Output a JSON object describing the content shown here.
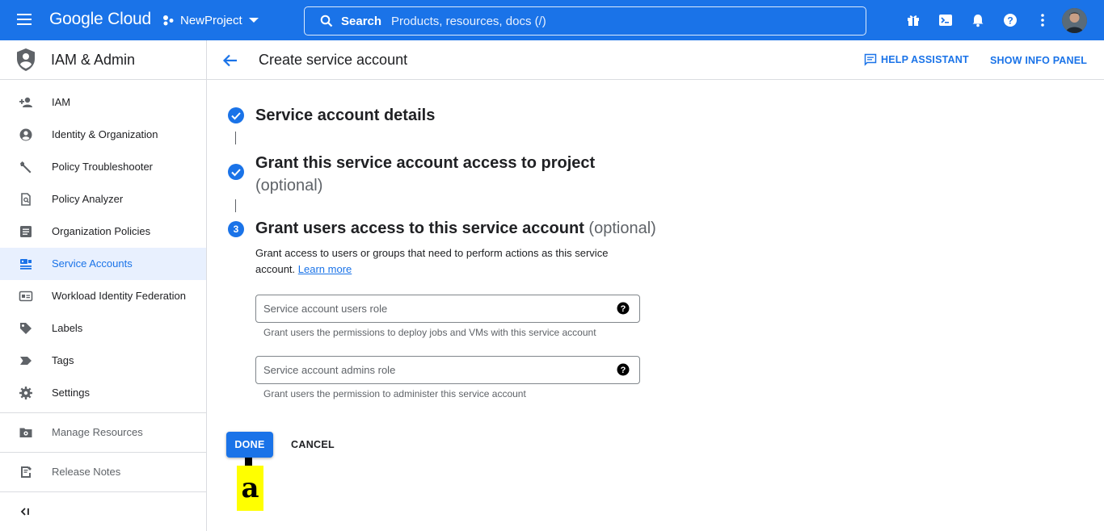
{
  "topbar": {
    "logo": "Google Cloud",
    "project": "NewProject",
    "search_label": "Search",
    "search_placeholder": "Products, resources, docs (/)",
    "icons": [
      "gift-icon",
      "terminal-icon",
      "bell-icon",
      "help-icon",
      "more-vert-icon"
    ],
    "color": "#1a73e8"
  },
  "sidebar": {
    "title": "IAM & Admin",
    "items": [
      {
        "label": "IAM",
        "icon": "person-add-icon"
      },
      {
        "label": "Identity & Organization",
        "icon": "account-circle-icon"
      },
      {
        "label": "Policy Troubleshooter",
        "icon": "wrench-icon"
      },
      {
        "label": "Policy Analyzer",
        "icon": "document-search-icon"
      },
      {
        "label": "Organization Policies",
        "icon": "list-doc-icon"
      },
      {
        "label": "Service Accounts",
        "icon": "service-account-icon",
        "active": true
      },
      {
        "label": "Workload Identity Federation",
        "icon": "id-card-icon"
      },
      {
        "label": "Labels",
        "icon": "label-icon"
      },
      {
        "label": "Tags",
        "icon": "tag-arrow-icon"
      },
      {
        "label": "Settings",
        "icon": "gear-icon"
      }
    ],
    "manage_resources": "Manage Resources",
    "release_notes": "Release Notes"
  },
  "main": {
    "title": "Create service account",
    "help_assistant": "HELP ASSISTANT",
    "show_info_panel": "SHOW INFO PANEL",
    "steps": [
      {
        "title": "Service account details",
        "state": "done"
      },
      {
        "title": "Grant this service account access to project",
        "optional": "(optional)",
        "state": "done"
      },
      {
        "number": "3",
        "title": "Grant users access to this service account",
        "optional": "(optional)",
        "state": "current"
      }
    ],
    "description": "Grant access to users or groups that need to perform actions as this service account.",
    "learn_more": "Learn more",
    "fields": [
      {
        "placeholder": "Service account users role",
        "hint": "Grant users the permissions to deploy jobs and VMs with this service account"
      },
      {
        "placeholder": "Service account admins role",
        "hint": "Grant users the permission to administer this service account"
      }
    ],
    "done": "DONE",
    "cancel": "CANCEL"
  },
  "annotation": {
    "marker_label": "a",
    "color": "#ffff00"
  }
}
